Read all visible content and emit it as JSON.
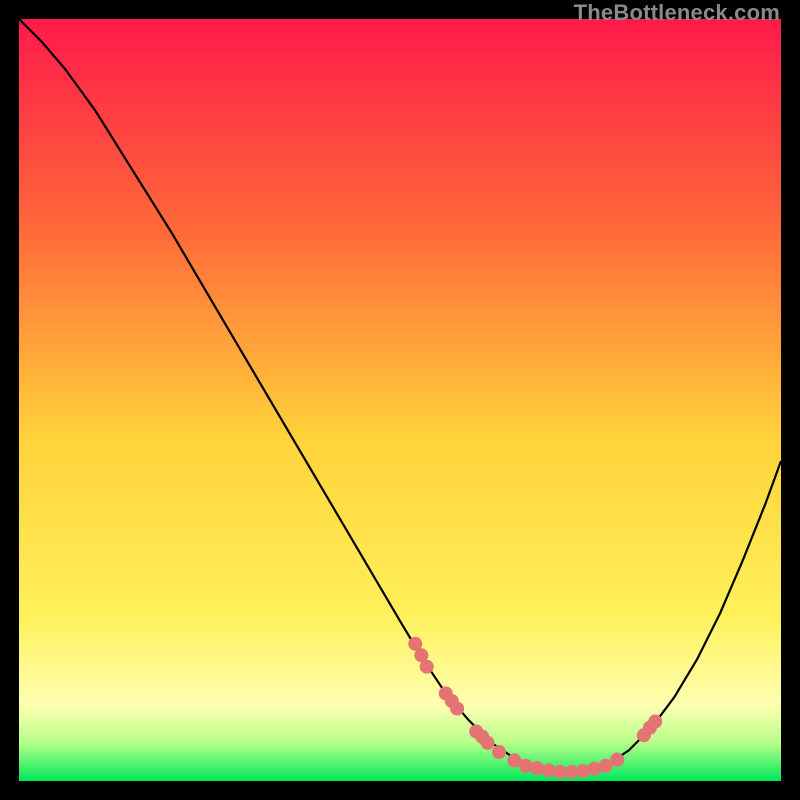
{
  "watermark": "TheBottleneck.com",
  "colors": {
    "gradient_top": "#ff1a4b",
    "gradient_mid_upper": "#ff6a3a",
    "gradient_mid": "#ffd23a",
    "gradient_mid_lower": "#fff05a",
    "gradient_low": "#ffffb0",
    "gradient_green_top": "#b6ff8a",
    "gradient_green": "#00e85a",
    "curve": "#000000",
    "marker": "#e57373",
    "background": "#000000"
  },
  "chart_data": {
    "type": "line",
    "title": "",
    "xlabel": "",
    "ylabel": "",
    "xlim": [
      0,
      100
    ],
    "ylim": [
      0,
      100
    ],
    "curve": {
      "x": [
        0,
        3,
        6,
        10,
        15,
        20,
        25,
        30,
        35,
        40,
        45,
        50,
        53,
        56,
        59,
        62,
        65,
        68,
        71,
        74,
        77,
        80,
        83,
        86,
        89,
        92,
        95,
        98,
        100
      ],
      "y": [
        100,
        97,
        93.5,
        88,
        80,
        72,
        63.5,
        55,
        46.5,
        38,
        29.5,
        21,
        16,
        11.5,
        8,
        5,
        3,
        1.8,
        1.2,
        1.2,
        2,
        4,
        7,
        11,
        16,
        22,
        29,
        36.5,
        42
      ]
    },
    "markers": [
      {
        "x": 52,
        "y": 18
      },
      {
        "x": 52.8,
        "y": 16.5
      },
      {
        "x": 53.5,
        "y": 15
      },
      {
        "x": 56,
        "y": 11.5
      },
      {
        "x": 56.8,
        "y": 10.5
      },
      {
        "x": 57.5,
        "y": 9.5
      },
      {
        "x": 60,
        "y": 6.5
      },
      {
        "x": 60.8,
        "y": 5.8
      },
      {
        "x": 61.5,
        "y": 5
      },
      {
        "x": 63,
        "y": 3.8
      },
      {
        "x": 65,
        "y": 2.7
      },
      {
        "x": 66.5,
        "y": 2
      },
      {
        "x": 68,
        "y": 1.7
      },
      {
        "x": 69.5,
        "y": 1.4
      },
      {
        "x": 71,
        "y": 1.2
      },
      {
        "x": 72.5,
        "y": 1.2
      },
      {
        "x": 74,
        "y": 1.3
      },
      {
        "x": 75.5,
        "y": 1.6
      },
      {
        "x": 77,
        "y": 2
      },
      {
        "x": 78.5,
        "y": 2.8
      },
      {
        "x": 82,
        "y": 6
      },
      {
        "x": 82.8,
        "y": 7
      },
      {
        "x": 83.5,
        "y": 7.8
      }
    ]
  }
}
